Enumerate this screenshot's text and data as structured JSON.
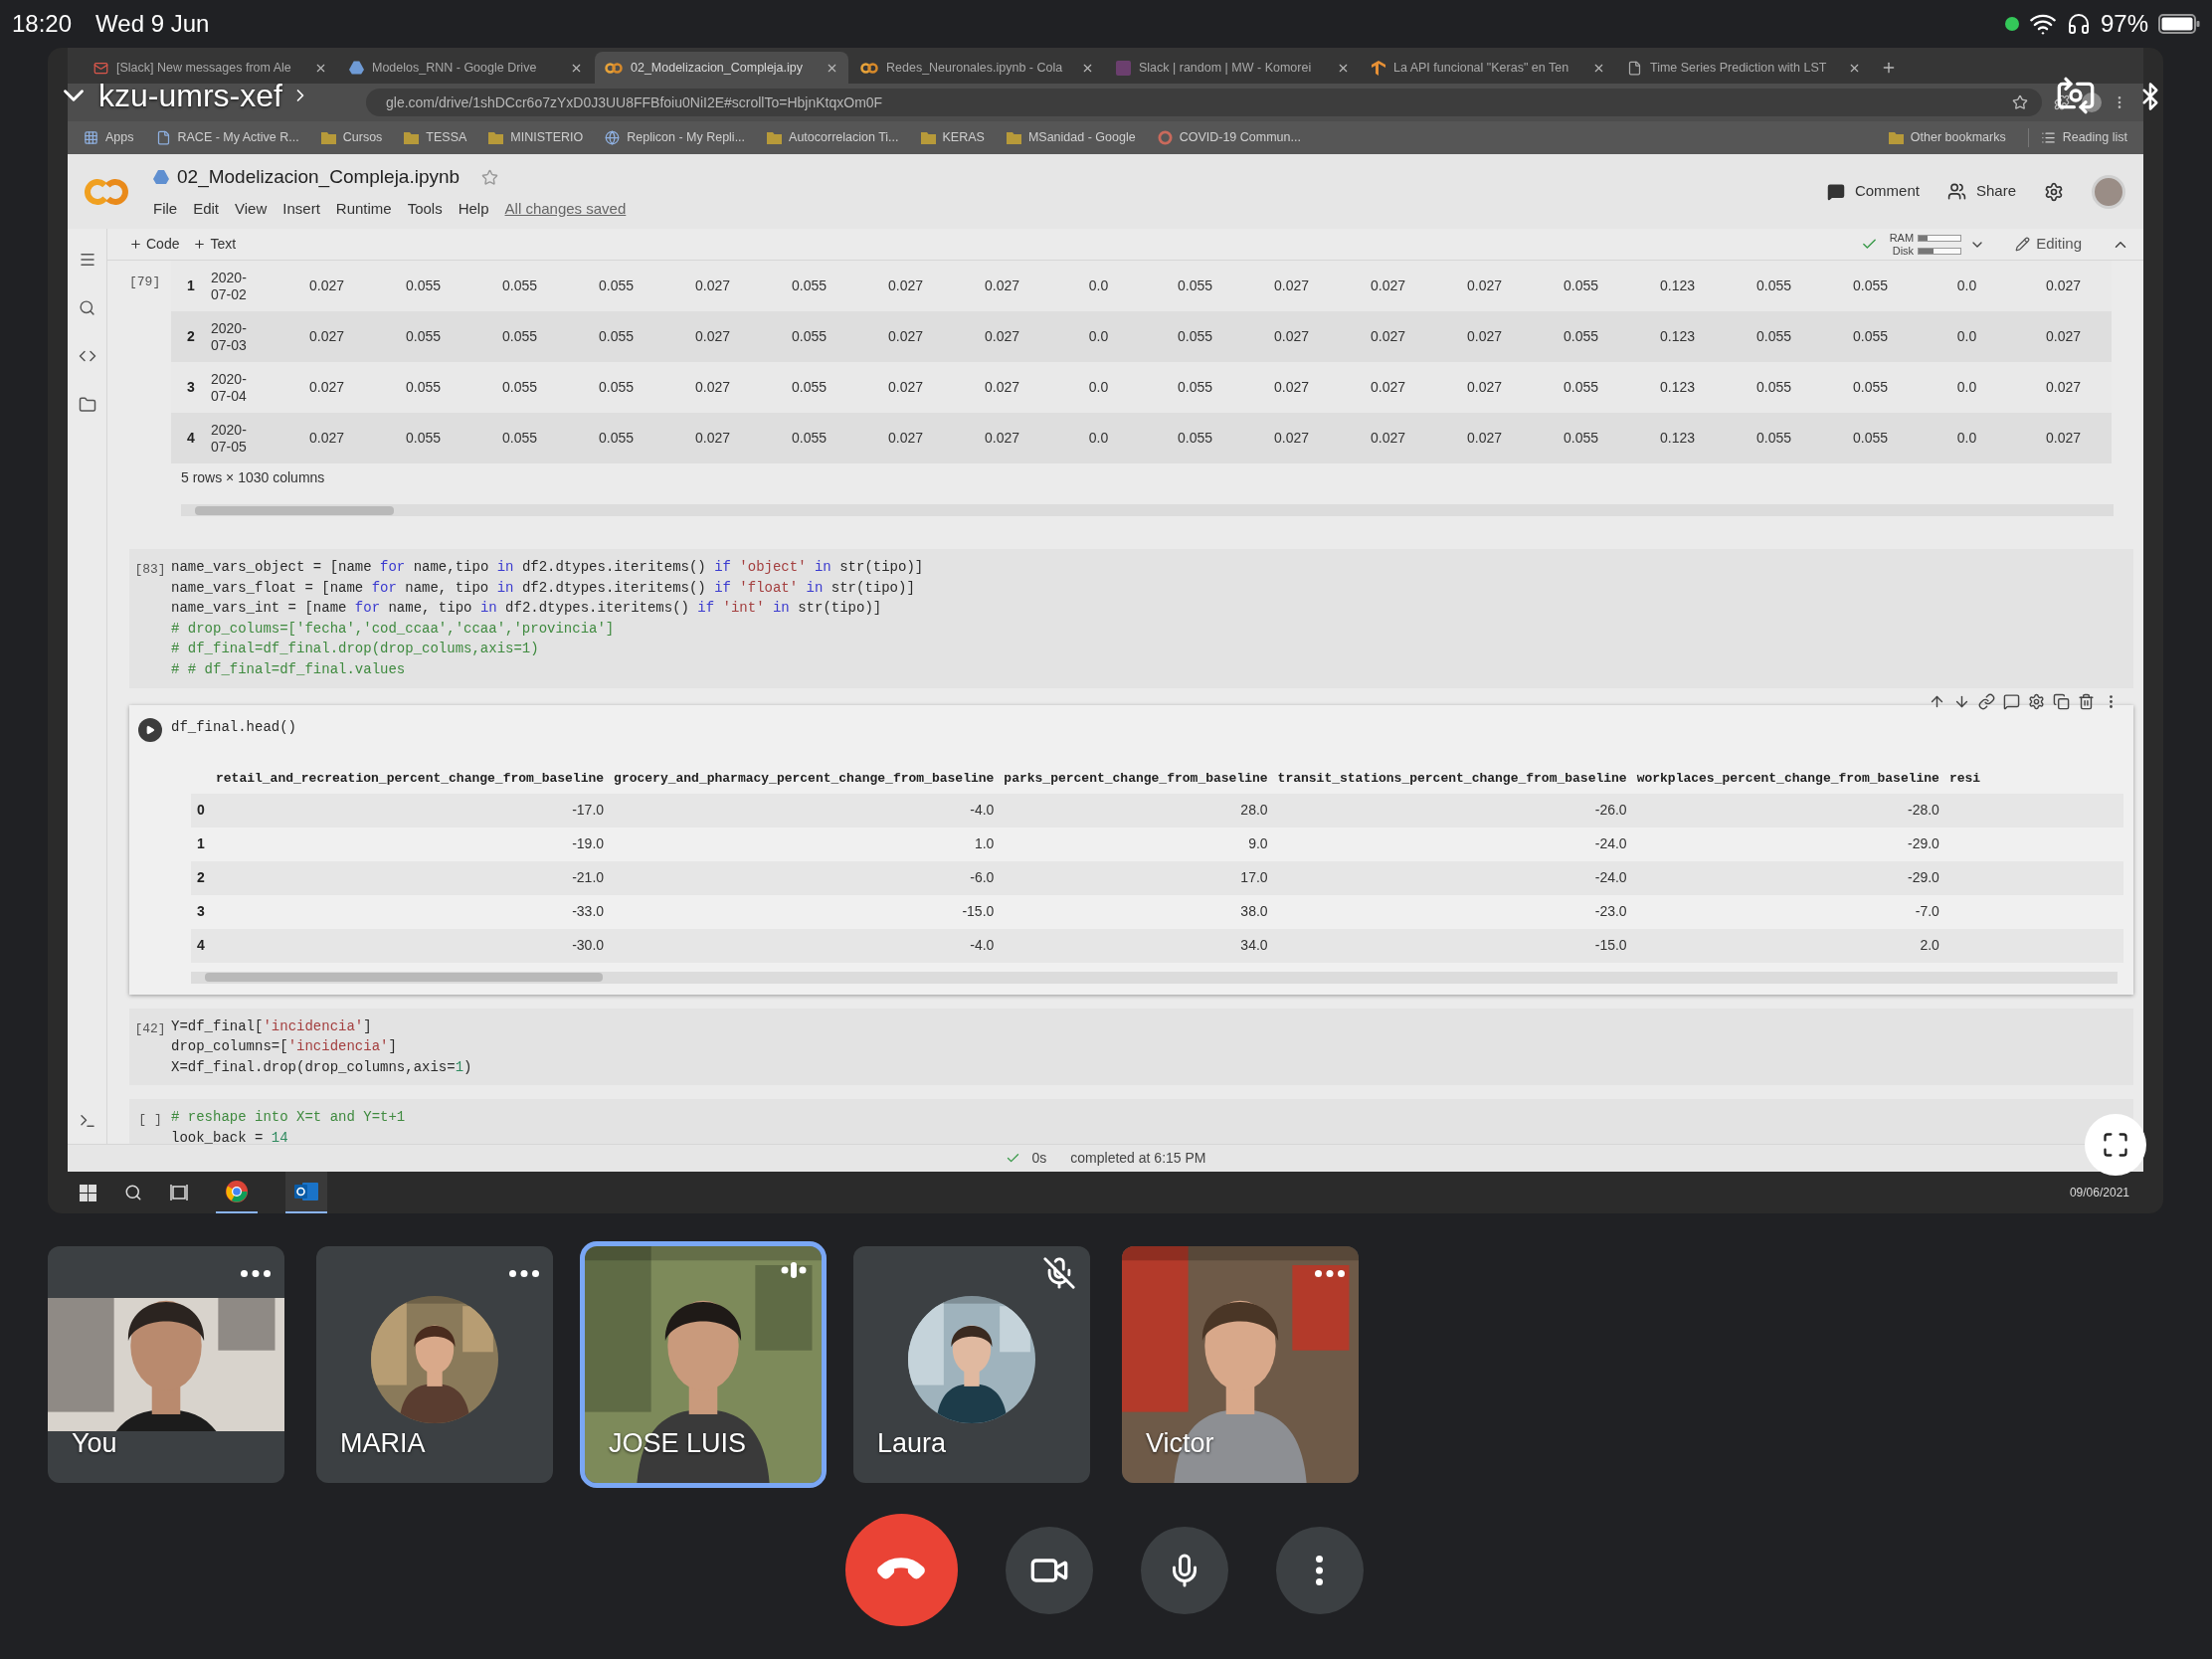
{
  "status_bar": {
    "time": "18:20",
    "date": "Wed 9 Jun",
    "battery": "97%"
  },
  "meeting": {
    "code": "kzu-umrs-xef"
  },
  "browser": {
    "tabs": [
      {
        "title": "[Slack] New messages from Ale",
        "kind": "mail",
        "selected": false
      },
      {
        "title": "Modelos_RNN - Google Drive",
        "kind": "drive",
        "selected": false
      },
      {
        "title": "02_Modelizacion_Compleja.ipy",
        "kind": "colab",
        "selected": true
      },
      {
        "title": "Redes_Neuronales.ipynb - Cola",
        "kind": "colab",
        "selected": false
      },
      {
        "title": "Slack | random | MW - Komorei",
        "kind": "slack",
        "selected": false
      },
      {
        "title": "La API funcional \"Keras\" en Ten",
        "kind": "tf",
        "selected": false
      },
      {
        "title": "Time Series Prediction with LST",
        "kind": "page",
        "selected": false
      }
    ],
    "address": "gle.com/drive/1shDCcr6o7zYxD0J3UU8FFBfoiu0NiI2E#scrollTo=HbjnKtqxOm0F",
    "bookmarks": [
      {
        "label": "Apps",
        "kind": "apps"
      },
      {
        "label": "RACE - My Active R...",
        "kind": "page"
      },
      {
        "label": "Cursos",
        "kind": "folder"
      },
      {
        "label": "TESSA",
        "kind": "folder"
      },
      {
        "label": "MINISTERIO",
        "kind": "folder"
      },
      {
        "label": "Replicon - My Repli...",
        "kind": "globe"
      },
      {
        "label": "Autocorrelacion Ti...",
        "kind": "folder"
      },
      {
        "label": "KERAS",
        "kind": "folder"
      },
      {
        "label": "MSanidad - Google",
        "kind": "folder"
      },
      {
        "label": "COVID-19 Commun...",
        "kind": "google"
      }
    ],
    "other_bookmarks": "Other bookmarks",
    "reading_list": "Reading list"
  },
  "notebook": {
    "file_name": "02_Modelizacion_Compleja.ipynb",
    "menu": [
      "File",
      "Edit",
      "View",
      "Insert",
      "Runtime",
      "Tools",
      "Help"
    ],
    "save_status": "All changes saved",
    "comment": "Comment",
    "share": "Share",
    "add_code": "Code",
    "add_text": "Text",
    "ram": {
      "label": "RAM",
      "level": 0.2
    },
    "disk": {
      "label": "Disk",
      "level": 0.35
    },
    "mode": "Editing",
    "cells": [
      {
        "kind": "table_output",
        "prompt": "[79]",
        "summary": "5 rows × 1030 columns",
        "rows": [
          {
            "index": "1",
            "date": "2020-07-02",
            "values": [
              "0.027",
              "0.055",
              "0.055",
              "0.055",
              "0.027",
              "0.055",
              "0.027",
              "0.027",
              "0.0",
              "0.055",
              "0.027",
              "0.027",
              "0.027",
              "0.055",
              "0.123",
              "0.055",
              "0.055",
              "0.0",
              "0.027"
            ]
          },
          {
            "index": "2",
            "date": "2020-07-03",
            "values": [
              "0.027",
              "0.055",
              "0.055",
              "0.055",
              "0.027",
              "0.055",
              "0.027",
              "0.027",
              "0.0",
              "0.055",
              "0.027",
              "0.027",
              "0.027",
              "0.055",
              "0.123",
              "0.055",
              "0.055",
              "0.0",
              "0.027"
            ]
          },
          {
            "index": "3",
            "date": "2020-07-04",
            "values": [
              "0.027",
              "0.055",
              "0.055",
              "0.055",
              "0.027",
              "0.055",
              "0.027",
              "0.027",
              "0.0",
              "0.055",
              "0.027",
              "0.027",
              "0.027",
              "0.055",
              "0.123",
              "0.055",
              "0.055",
              "0.0",
              "0.027"
            ]
          },
          {
            "index": "4",
            "date": "2020-07-05",
            "values": [
              "0.027",
              "0.055",
              "0.055",
              "0.055",
              "0.027",
              "0.055",
              "0.027",
              "0.027",
              "0.0",
              "0.055",
              "0.027",
              "0.027",
              "0.027",
              "0.055",
              "0.123",
              "0.055",
              "0.055",
              "0.0",
              "0.027"
            ]
          }
        ]
      },
      {
        "kind": "code",
        "prompt": "[83]",
        "active": false,
        "lines": [
          [
            {
              "kind": "plain",
              "text": "name_vars_object = [name "
            },
            {
              "kind": "keyword",
              "text": "for"
            },
            {
              "kind": "plain",
              "text": " name,tipo "
            },
            {
              "kind": "keyword",
              "text": "in"
            },
            {
              "kind": "plain",
              "text": " df2.dtypes.iteritems() "
            },
            {
              "kind": "keyword",
              "text": "if"
            },
            {
              "kind": "string",
              "text": " 'object' "
            },
            {
              "kind": "keyword",
              "text": "in"
            },
            {
              "kind": "plain",
              "text": " str(tipo)]"
            }
          ],
          [
            {
              "kind": "plain",
              "text": "name_vars_float = [name "
            },
            {
              "kind": "keyword",
              "text": "for"
            },
            {
              "kind": "plain",
              "text": " name, tipo "
            },
            {
              "kind": "keyword",
              "text": "in"
            },
            {
              "kind": "plain",
              "text": " df2.dtypes.iteritems() "
            },
            {
              "kind": "keyword",
              "text": "if"
            },
            {
              "kind": "string",
              "text": " 'float' "
            },
            {
              "kind": "keyword",
              "text": "in"
            },
            {
              "kind": "plain",
              "text": " str(tipo)]"
            }
          ],
          [
            {
              "kind": "plain",
              "text": "name_vars_int = [name "
            },
            {
              "kind": "keyword",
              "text": "for"
            },
            {
              "kind": "plain",
              "text": " name, tipo "
            },
            {
              "kind": "keyword",
              "text": "in"
            },
            {
              "kind": "plain",
              "text": " df2.dtypes.iteritems() "
            },
            {
              "kind": "keyword",
              "text": "if"
            },
            {
              "kind": "string",
              "text": " 'int' "
            },
            {
              "kind": "keyword",
              "text": "in"
            },
            {
              "kind": "plain",
              "text": " str(tipo)]"
            }
          ],
          [
            {
              "kind": "comment",
              "text": "# drop_colums=['fecha','cod_ccaa','ccaa','provincia']"
            }
          ],
          [
            {
              "kind": "comment",
              "text": "# df_final=df_final.drop(drop_colums,axis=1)"
            }
          ],
          [
            {
              "kind": "comment",
              "text": "# # df_final=df_final.values"
            }
          ]
        ]
      },
      {
        "kind": "code",
        "active": true,
        "lines": [
          [
            {
              "kind": "plain",
              "text": "df_final.head()"
            }
          ]
        ],
        "output": {
          "columns": [
            "retail_and_recreation_percent_change_from_baseline",
            "grocery_and_pharmacy_percent_change_from_baseline",
            "parks_percent_change_from_baseline",
            "transit_stations_percent_change_from_baseline",
            "workplaces_percent_change_from_baseline",
            "resi"
          ],
          "rows": [
            {
              "index": "0",
              "values": [
                "-17.0",
                "-4.0",
                "28.0",
                "-26.0",
                "-28.0"
              ]
            },
            {
              "index": "1",
              "values": [
                "-19.0",
                "1.0",
                "9.0",
                "-24.0",
                "-29.0"
              ]
            },
            {
              "index": "2",
              "values": [
                "-21.0",
                "-6.0",
                "17.0",
                "-24.0",
                "-29.0"
              ]
            },
            {
              "index": "3",
              "values": [
                "-33.0",
                "-15.0",
                "38.0",
                "-23.0",
                "-7.0"
              ]
            },
            {
              "index": "4",
              "values": [
                "-30.0",
                "-4.0",
                "34.0",
                "-15.0",
                "2.0"
              ]
            }
          ]
        }
      },
      {
        "kind": "code",
        "prompt": "[42]",
        "active": false,
        "lines": [
          [
            {
              "kind": "plain",
              "text": "Y=df_final["
            },
            {
              "kind": "string",
              "text": "'incidencia'"
            },
            {
              "kind": "plain",
              "text": "]"
            }
          ],
          [
            {
              "kind": "plain",
              "text": "drop_columns=["
            },
            {
              "kind": "string",
              "text": "'incidencia'"
            },
            {
              "kind": "plain",
              "text": "]"
            }
          ],
          [
            {
              "kind": "plain",
              "text": "X=df_final.drop(drop_columns,axis="
            },
            {
              "kind": "number",
              "text": "1"
            },
            {
              "kind": "plain",
              "text": ")"
            }
          ]
        ]
      },
      {
        "kind": "code",
        "prompt": "[ ]",
        "active": false,
        "lines": [
          [
            {
              "kind": "comment",
              "text": "# reshape into X=t and Y=t+1"
            }
          ],
          [
            {
              "kind": "plain",
              "text": "look_back = "
            },
            {
              "kind": "number",
              "text": "14"
            }
          ]
        ]
      }
    ],
    "status": {
      "duration": "0s",
      "message": "completed at 6:15 PM"
    }
  },
  "taskbar": {
    "date": "09/06/2021"
  },
  "participants": [
    {
      "name": "You",
      "kind": "self_video",
      "speaking": false,
      "muted": false
    },
    {
      "name": "MARIA",
      "kind": "avatar",
      "speaking": false,
      "muted": false
    },
    {
      "name": "JOSE LUIS",
      "kind": "video",
      "speaking": true,
      "muted": false
    },
    {
      "name": "Laura",
      "kind": "avatar",
      "speaking": false,
      "muted": true
    },
    {
      "name": "Victor",
      "kind": "video",
      "speaking": false,
      "muted": false
    }
  ]
}
